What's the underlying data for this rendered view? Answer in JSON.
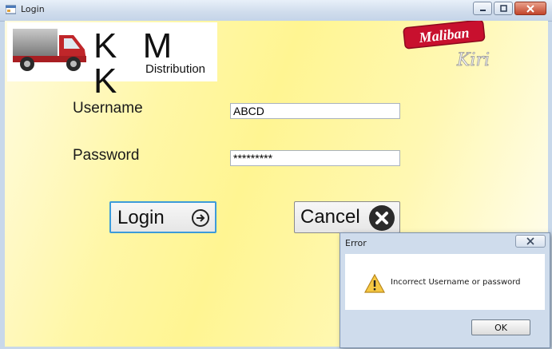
{
  "window": {
    "title": "Login"
  },
  "logo": {
    "letters": "K M K",
    "subtitle": "Distribution"
  },
  "brand": {
    "name": "Maliban",
    "sub": "Kiri"
  },
  "form": {
    "username_label": "Username",
    "username_value": "ABCD",
    "password_label": "Password",
    "password_value": "*********"
  },
  "buttons": {
    "login": "Login",
    "cancel": "Cancel"
  },
  "dialog": {
    "title": "Error",
    "message": "Incorrect Username or password",
    "ok": "OK"
  },
  "colors": {
    "accent": "#3d9bd9",
    "brand_red": "#c8102e",
    "background_yellow": "#fff592"
  }
}
